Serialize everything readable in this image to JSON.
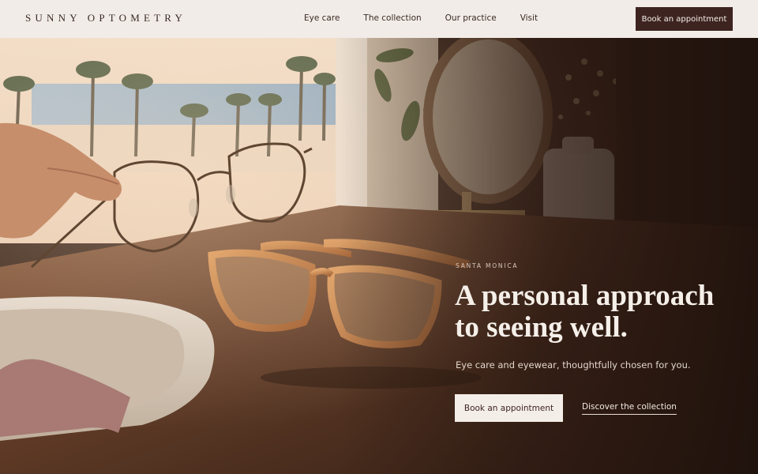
{
  "brand": {
    "name": "SUNNY OPTOMETRY"
  },
  "nav": {
    "items": [
      {
        "label": "Eye care"
      },
      {
        "label": "The collection"
      },
      {
        "label": "Our practice"
      },
      {
        "label": "Visit"
      }
    ],
    "cta_label": "Book an appointment"
  },
  "hero": {
    "eyebrow": "SANTA MONICA",
    "headline_line1": "A personal approach",
    "headline_line2": "to seeing well.",
    "subline": "Eye care and eyewear, thoughtfully chosen for you.",
    "primary_cta": "Book an appointment",
    "secondary_link": "Discover the collection",
    "image_alt": "Hand holding wire-frame glasses above a wooden table with tortoiseshell glasses, a round mirror, and a stone tray"
  },
  "colors": {
    "header_bg": "#f2ece8",
    "brand_dark": "#3d2420",
    "cream": "#f4eee9",
    "hero_text": "#f5efe9"
  }
}
